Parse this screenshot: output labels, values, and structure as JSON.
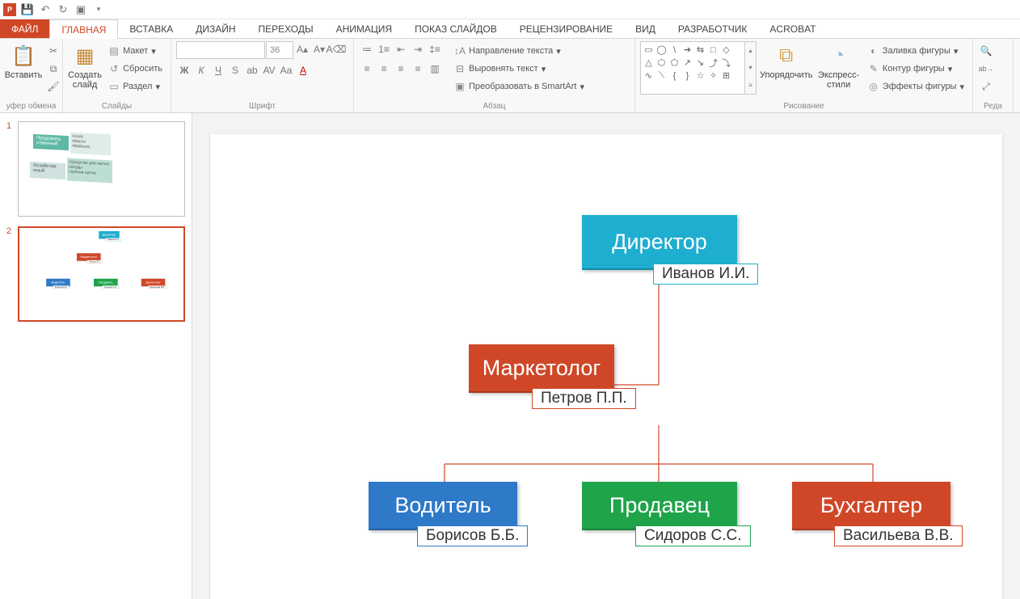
{
  "qat": {
    "save": "save",
    "undo": "undo",
    "redo": "redo",
    "start": "start"
  },
  "tabs": {
    "file": "ФАЙЛ",
    "home": "ГЛАВНАЯ",
    "insert": "ВСТАВКА",
    "design": "ДИЗАЙН",
    "transitions": "ПЕРЕХОДЫ",
    "animation": "АНИМАЦИЯ",
    "slideshow": "ПОКАЗ СЛАЙДОВ",
    "review": "РЕЦЕНЗИРОВАНИЕ",
    "view": "ВИД",
    "developer": "РАЗРАБОТЧИК",
    "acrobat": "ACROBAT"
  },
  "ribbon": {
    "clipboard": {
      "paste": "Вставить",
      "label": "уфер обмена"
    },
    "slides": {
      "new": "Создать слайд",
      "layout": "Макет",
      "reset": "Сбросить",
      "section": "Раздел",
      "label": "Слайды"
    },
    "font": {
      "size": "36",
      "label": "Шрифт"
    },
    "paragraph": {
      "textdir": "Направление текста",
      "align": "Выровнять текст",
      "smartart": "Преобразовать в SmartArt",
      "label": "Абзац"
    },
    "drawing": {
      "arrange": "Упорядочить",
      "quick": "Экспресс-стили",
      "fill": "Заливка фигуры",
      "outline": "Контур фигуры",
      "effects": "Эффекты фигуры",
      "label": "Рисование"
    },
    "edit": {
      "label": "Реда"
    }
  },
  "thumbs": {
    "n1": "1",
    "n2": "2"
  },
  "thumb1": {
    "a": "Продоволь ственный",
    "a_items": "•Хлеб\n•Масло\n•Майонез",
    "b": "Хозяйстве нный",
    "b_items": "•Средство для мытья посуды\n•Зубная щетка"
  },
  "org": {
    "director": {
      "title": "Директор",
      "name": "Иванов И.И."
    },
    "marketolog": {
      "title": "Маркетолог",
      "name": "Петров П.П."
    },
    "driver": {
      "title": "Водитель",
      "name": "Борисов Б.Б."
    },
    "seller": {
      "title": "Продавец",
      "name": "Сидоров С.С."
    },
    "accountant": {
      "title": "Бухгалтер",
      "name": "Васильева В.В."
    }
  }
}
